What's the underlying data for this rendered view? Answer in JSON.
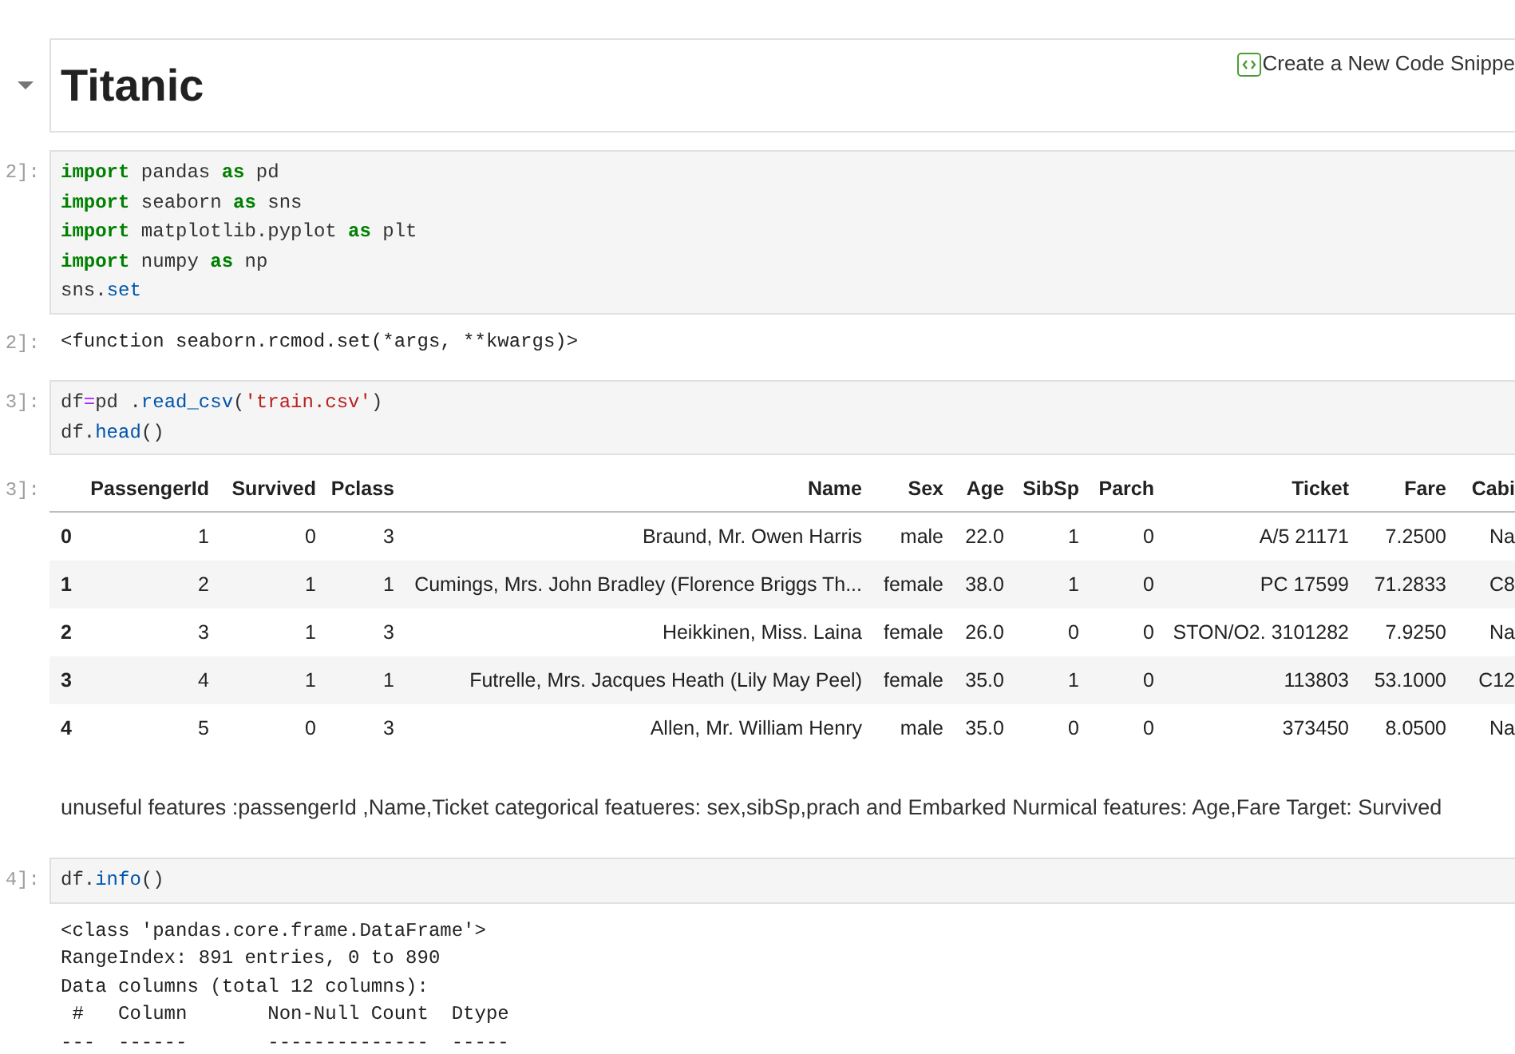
{
  "heading_cell": {
    "expanded": true,
    "title": "Titanic",
    "snippet_link": "Create a New Code Snippe"
  },
  "cells": [
    {
      "kind": "code",
      "prompt": "2]:",
      "lines": [
        [
          {
            "kind": "keyword",
            "text": "import"
          },
          {
            "kind": "plain",
            "text": " pandas "
          },
          {
            "kind": "keyword",
            "text": "as"
          },
          {
            "kind": "plain",
            "text": " pd"
          }
        ],
        [
          {
            "kind": "keyword",
            "text": "import"
          },
          {
            "kind": "plain",
            "text": " seaborn "
          },
          {
            "kind": "keyword",
            "text": "as"
          },
          {
            "kind": "plain",
            "text": " sns"
          }
        ],
        [
          {
            "kind": "keyword",
            "text": "import"
          },
          {
            "kind": "plain",
            "text": " matplotlib.pyplot "
          },
          {
            "kind": "keyword",
            "text": "as"
          },
          {
            "kind": "plain",
            "text": " plt"
          }
        ],
        [
          {
            "kind": "keyword",
            "text": "import"
          },
          {
            "kind": "plain",
            "text": " numpy "
          },
          {
            "kind": "keyword",
            "text": "as"
          },
          {
            "kind": "plain",
            "text": " np"
          }
        ],
        [
          {
            "kind": "plain",
            "text": "sns."
          },
          {
            "kind": "attr",
            "text": "set"
          }
        ]
      ]
    },
    {
      "kind": "output",
      "prompt": "2]:",
      "lines": [
        "<function seaborn.rcmod.set(*args, **kwargs)>"
      ]
    },
    {
      "kind": "code",
      "prompt": "3]:",
      "lines": [
        [
          {
            "kind": "plain",
            "text": "df"
          },
          {
            "kind": "operator",
            "text": "="
          },
          {
            "kind": "plain",
            "text": "pd ."
          },
          {
            "kind": "attr",
            "text": "read_csv"
          },
          {
            "kind": "plain",
            "text": "("
          },
          {
            "kind": "string",
            "text": "'train.csv'"
          },
          {
            "kind": "plain",
            "text": ")"
          }
        ],
        [
          {
            "kind": "plain",
            "text": "df."
          },
          {
            "kind": "attr",
            "text": "head"
          },
          {
            "kind": "plain",
            "text": "()"
          }
        ]
      ]
    },
    {
      "kind": "table",
      "prompt": "3]:",
      "columns": [
        "PassengerId",
        "Survived",
        "Pclass",
        "Name",
        "Sex",
        "Age",
        "SibSp",
        "Parch",
        "Ticket",
        "Fare",
        "Cabi"
      ],
      "rows": [
        {
          "index": "0",
          "cells": [
            "1",
            "0",
            "3",
            "Braund, Mr. Owen Harris",
            "male",
            "22.0",
            "1",
            "0",
            "A/5 21171",
            "7.2500",
            "Na"
          ]
        },
        {
          "index": "1",
          "cells": [
            "2",
            "1",
            "1",
            "Cumings, Mrs. John Bradley (Florence Briggs Th...",
            "female",
            "38.0",
            "1",
            "0",
            "PC 17599",
            "71.2833",
            "C8"
          ]
        },
        {
          "index": "2",
          "cells": [
            "3",
            "1",
            "3",
            "Heikkinen, Miss. Laina",
            "female",
            "26.0",
            "0",
            "0",
            "STON/O2. 3101282",
            "7.9250",
            "Na"
          ]
        },
        {
          "index": "3",
          "cells": [
            "4",
            "1",
            "1",
            "Futrelle, Mrs. Jacques Heath (Lily May Peel)",
            "female",
            "35.0",
            "1",
            "0",
            "113803",
            "53.1000",
            "C12"
          ]
        },
        {
          "index": "4",
          "cells": [
            "5",
            "0",
            "3",
            "Allen, Mr. William Henry",
            "male",
            "35.0",
            "0",
            "0",
            "373450",
            "8.0500",
            "Na"
          ]
        }
      ]
    },
    {
      "kind": "markdown",
      "text": "unuseful features :passengerId ,Name,Ticket categorical featueres: sex,sibSp,prach and Embarked Nurmical features: Age,Fare Target: Survived"
    },
    {
      "kind": "code",
      "prompt": "4]:",
      "lines": [
        [
          {
            "kind": "plain",
            "text": "df."
          },
          {
            "kind": "attr",
            "text": "info"
          },
          {
            "kind": "plain",
            "text": "()"
          }
        ]
      ]
    },
    {
      "kind": "output",
      "lines": [
        "<class 'pandas.core.frame.DataFrame'>",
        "RangeIndex: 891 entries, 0 to 890",
        "Data columns (total 12 columns):",
        " #   Column       Non-Null Count  Dtype",
        "---  ------       --------------  -----"
      ]
    }
  ]
}
